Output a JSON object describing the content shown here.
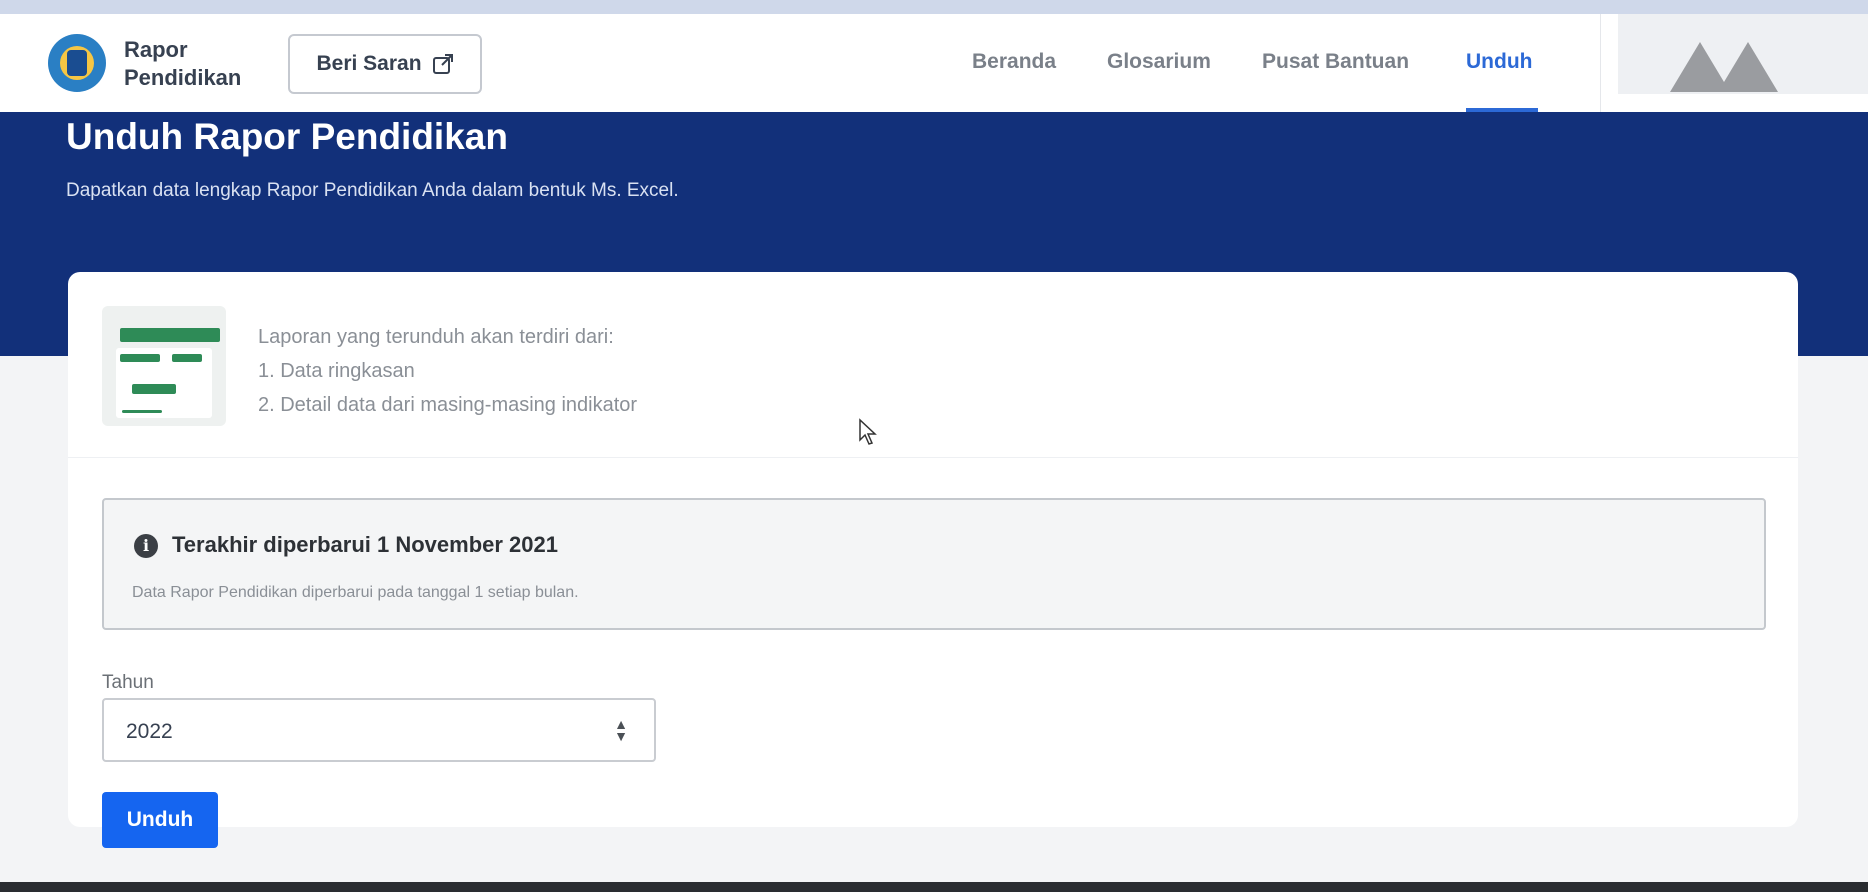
{
  "header": {
    "brand_line1": "Rapor",
    "brand_line2": "Pendidikan",
    "feedback_button": "Beri Saran",
    "nav": [
      "Beranda",
      "Glosarium",
      "Pusat Bantuan",
      "Unduh"
    ],
    "active_nav": "Unduh"
  },
  "hero": {
    "title": "Unduh Rapor Pendidikan",
    "subtitle": "Dapatkan data lengkap Rapor Pendidikan Anda dalam bentuk Ms. Excel."
  },
  "report_info": {
    "intro": "Laporan yang terunduh akan terdiri dari:",
    "items": [
      "1. Data ringkasan",
      "2. Detail data dari masing-masing indikator"
    ]
  },
  "update_notice": {
    "title": "Terakhir diperbarui 1 November 2021",
    "description": "Data Rapor Pendidikan diperbarui pada tanggal 1 setiap bulan."
  },
  "form": {
    "year_label": "Tahun",
    "year_value": "2022",
    "submit_label": "Unduh"
  },
  "colors": {
    "hero_bg": "#12307a",
    "accent": "#1565f0",
    "nav_active": "#2c69d6"
  }
}
